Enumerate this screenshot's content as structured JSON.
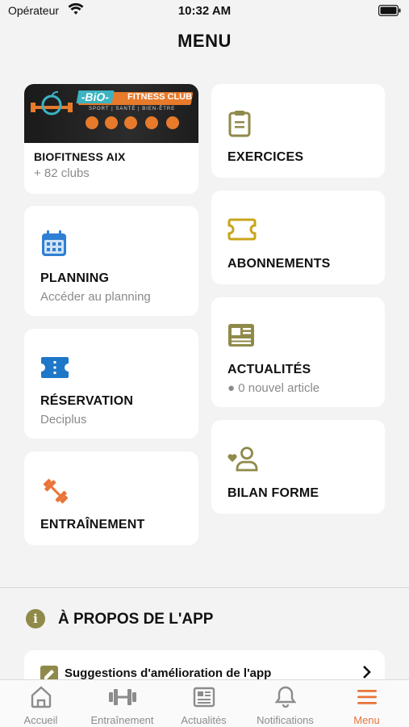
{
  "status_bar": {
    "carrier": "Opérateur",
    "time": "10:32 AM"
  },
  "title": "MENU",
  "club": {
    "name": "BIOFITNESS AIX",
    "clubs_count": "+ 82 clubs",
    "banner": {
      "brand": "-BiO-",
      "tagline": "FITNESS CLUB",
      "subline": "SPORT | SANTÉ | BIEN-ÊTRE"
    }
  },
  "left_cards": [
    {
      "label": "PLANNING",
      "sub": "Accéder au planning",
      "icon": "calendar-icon"
    },
    {
      "label": "RÉSERVATION",
      "sub": "Deciplus",
      "icon": "ticket-icon"
    },
    {
      "label": "ENTRAÎNEMENT",
      "sub": "",
      "icon": "dumbbell-icon"
    }
  ],
  "right_cards": [
    {
      "label": "EXERCICES",
      "sub": "",
      "icon": "clipboard-icon"
    },
    {
      "label": "ABONNEMENTS",
      "sub": "",
      "icon": "ticket-outline-icon"
    },
    {
      "label": "ACTUALITÉS",
      "sub": "● 0 nouvel article",
      "icon": "newspaper-icon"
    },
    {
      "label": "BILAN FORME",
      "sub": "",
      "icon": "user-heart-icon"
    }
  ],
  "about": {
    "title": "À PROPOS DE L'APP",
    "icon_glyph": "i",
    "suggestion": "Suggestions d'amélioration de l'app"
  },
  "tabs": [
    {
      "label": "Accueil",
      "icon": "home-icon"
    },
    {
      "label": "Entraînement",
      "icon": "dumbbell-icon"
    },
    {
      "label": "Actualités",
      "icon": "newspaper-icon"
    },
    {
      "label": "Notifications",
      "icon": "bell-icon"
    },
    {
      "label": "Menu",
      "icon": "menu-icon",
      "active": true
    }
  ],
  "colors": {
    "accent": "#e8743b",
    "blue": "#2f7fd3",
    "gold": "#c9a51a",
    "olive": "#8f8a49",
    "background": "#f3f3f3"
  }
}
